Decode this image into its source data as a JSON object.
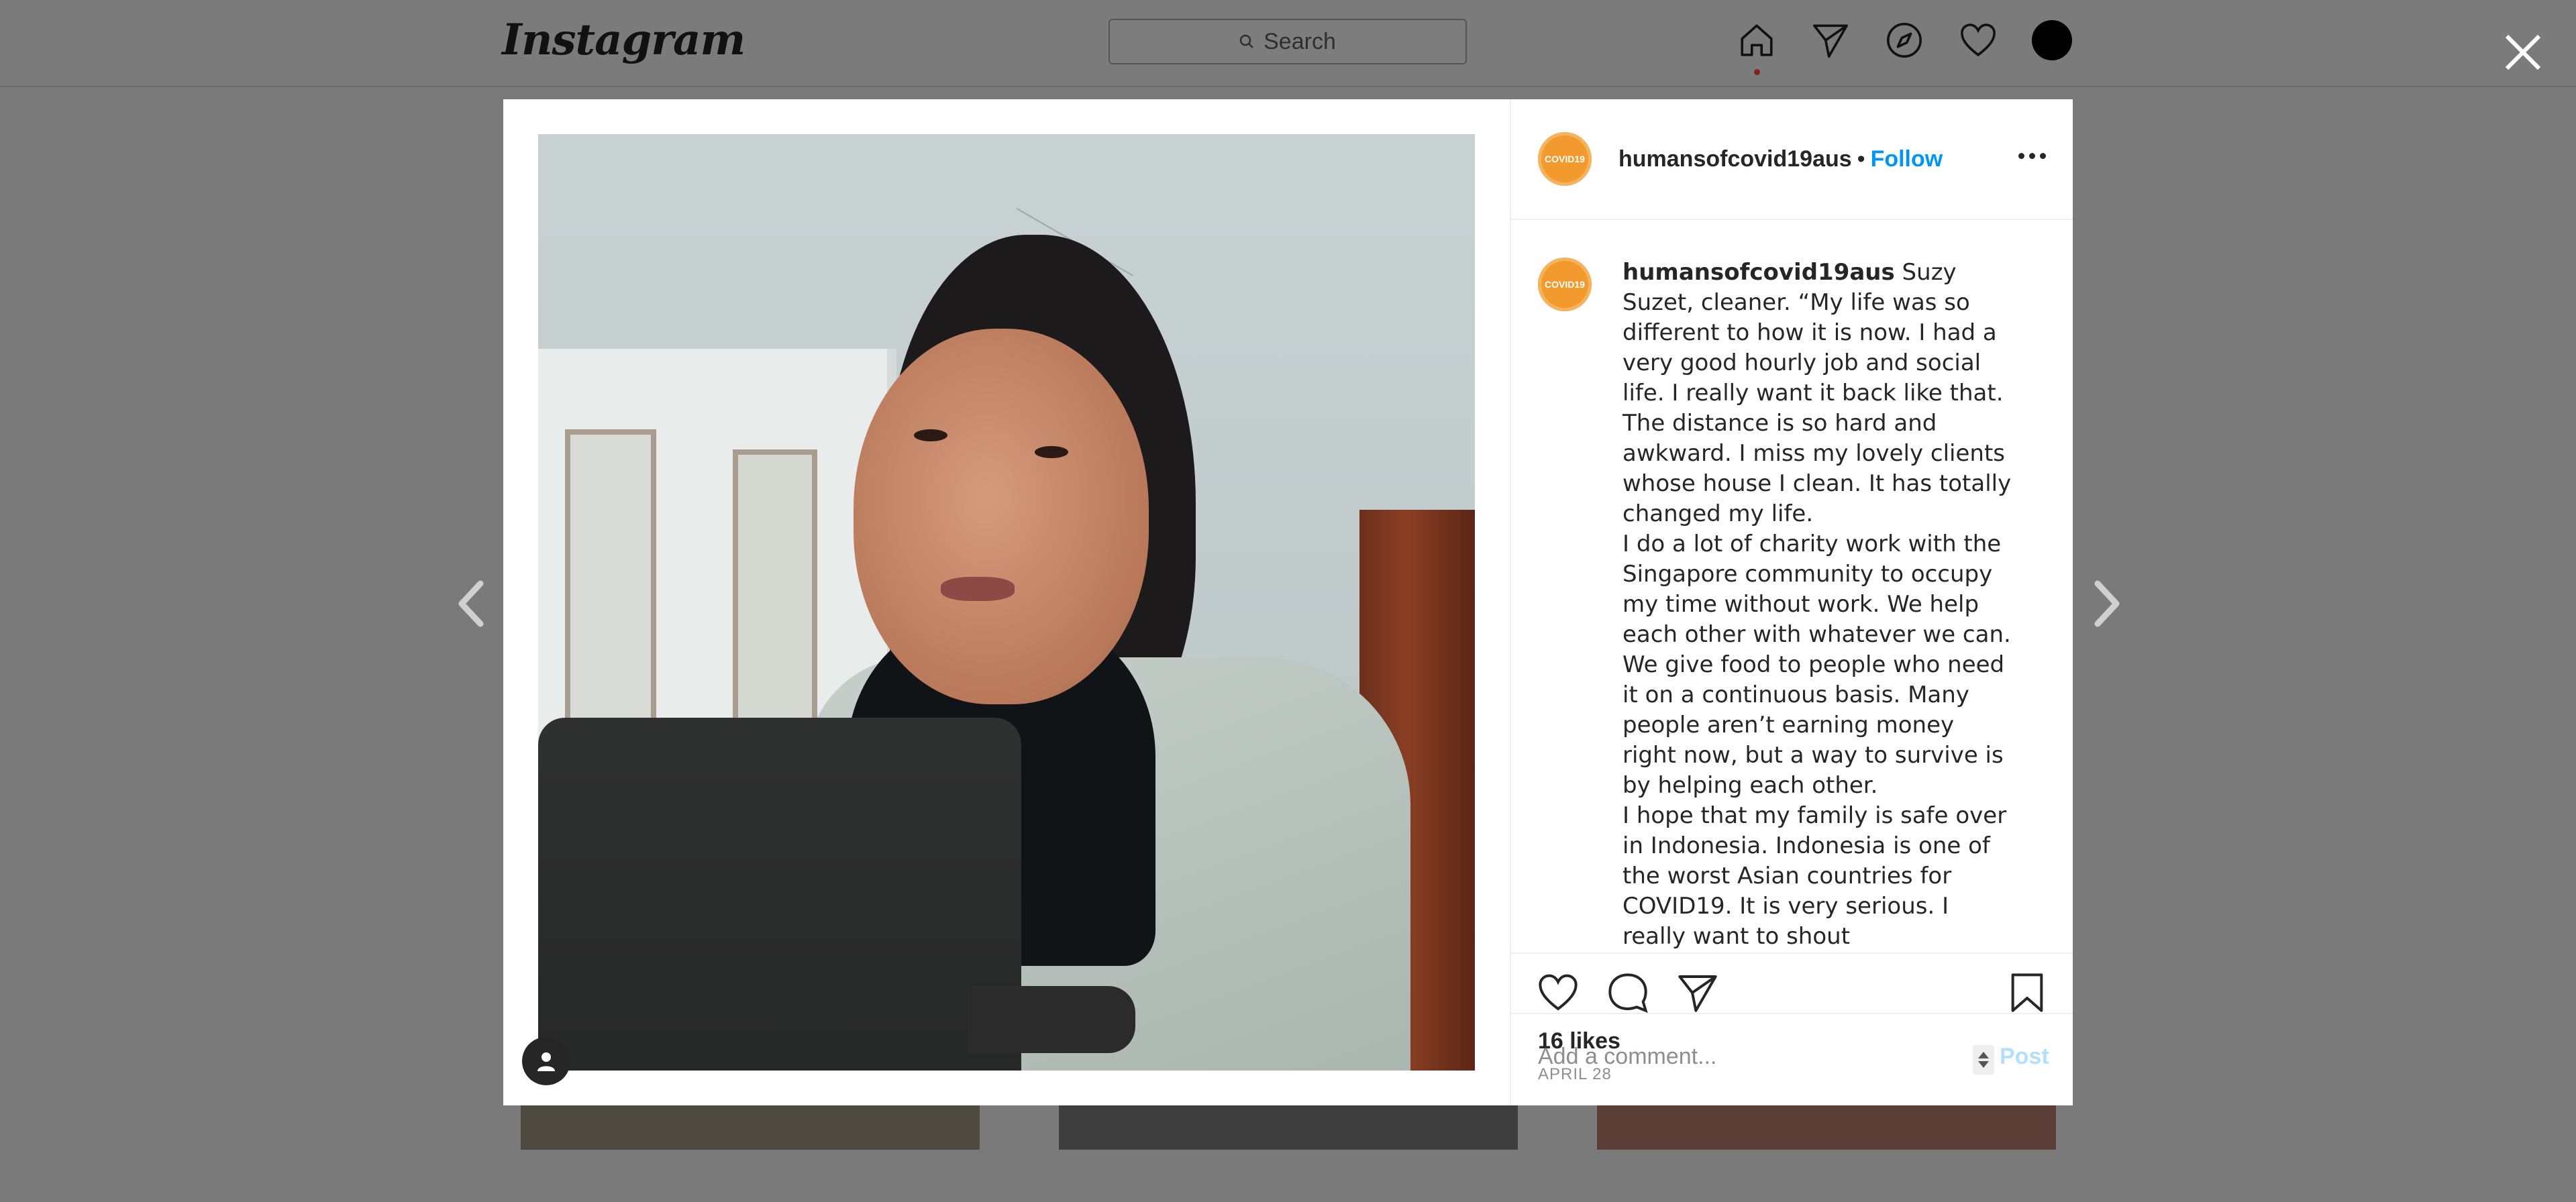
{
  "header": {
    "logo": "Instagram",
    "search_placeholder": "Search"
  },
  "post": {
    "username": "humansofcovid19aus",
    "dot": "•",
    "follow_label": "Follow",
    "avatar_text": "COVID19",
    "caption_user": "humansofcovid19aus",
    "caption": " Suzy Suzet, cleaner. “My life was so different to how it is now. I had a very good hourly job and social life. I really want it back like that. The distance is so hard and awkward. I miss my lovely clients whose house I clean. It has totally changed my life.\nI do a lot of charity work with the Singapore community to occupy my time without work. We help each other with whatever we can. We give food to people who need it on a continuous basis. Many people aren’t earning money right now, but a way to survive is by helping each other.\nI hope that my family is safe over in Indonesia. Indonesia is one of the worst Asian countries for COVID19. It is very serious. I really want to shout",
    "likes": "16 likes",
    "date": "APRIL 28",
    "comment_placeholder": "Add a comment...",
    "post_label": "Post"
  },
  "colors": {
    "accent": "#0095f6",
    "badge": "#f29a2e"
  }
}
